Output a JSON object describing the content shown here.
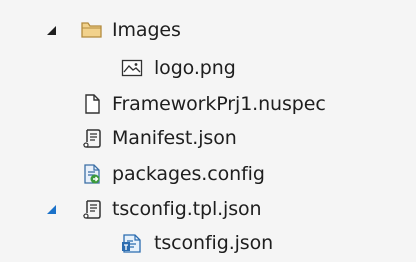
{
  "tree": {
    "items": [
      {
        "label": "Images",
        "icon": "folder-icon",
        "expander": "expanded",
        "level": 1
      },
      {
        "label": "logo.png",
        "icon": "image-file-icon",
        "level": 2
      },
      {
        "label": "FrameworkPrj1.nuspec",
        "icon": "generic-file-icon",
        "level": 1
      },
      {
        "label": "Manifest.json",
        "icon": "json-file-icon",
        "level": 1
      },
      {
        "label": "packages.config",
        "icon": "config-file-icon",
        "level": 1
      },
      {
        "label": "tsconfig.tpl.json",
        "icon": "json-file-icon",
        "expander": "expanded-selected",
        "level": 1
      },
      {
        "label": "tsconfig.json",
        "icon": "tsconfig-file-icon",
        "level": 2
      }
    ]
  },
  "colors": {
    "background": "#f5f5f5",
    "text": "#1e1e1e",
    "expander_dark": "#1e1e1e",
    "expander_accent": "#1b72c9",
    "folder": "#dcb67a"
  }
}
